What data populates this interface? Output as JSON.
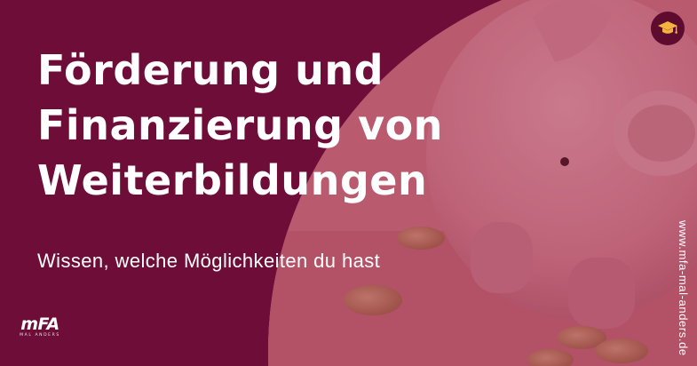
{
  "headline": {
    "line1": "Förderung und",
    "line2": "Finanzierung von",
    "line3": "Weiterbildungen"
  },
  "subtitle": "Wissen, welche Möglichkeiten du hast",
  "side_url": "www.mfa-mal-anders.de",
  "logo": {
    "mark": "mFA",
    "sub": "MAL ANDERS"
  },
  "badge": {
    "icon": "graduation-cap-icon"
  },
  "colors": {
    "background": "#6e0d38",
    "badge": "#5e0b30",
    "accent_cap": "#f3b53f",
    "text": "#ffffff"
  }
}
